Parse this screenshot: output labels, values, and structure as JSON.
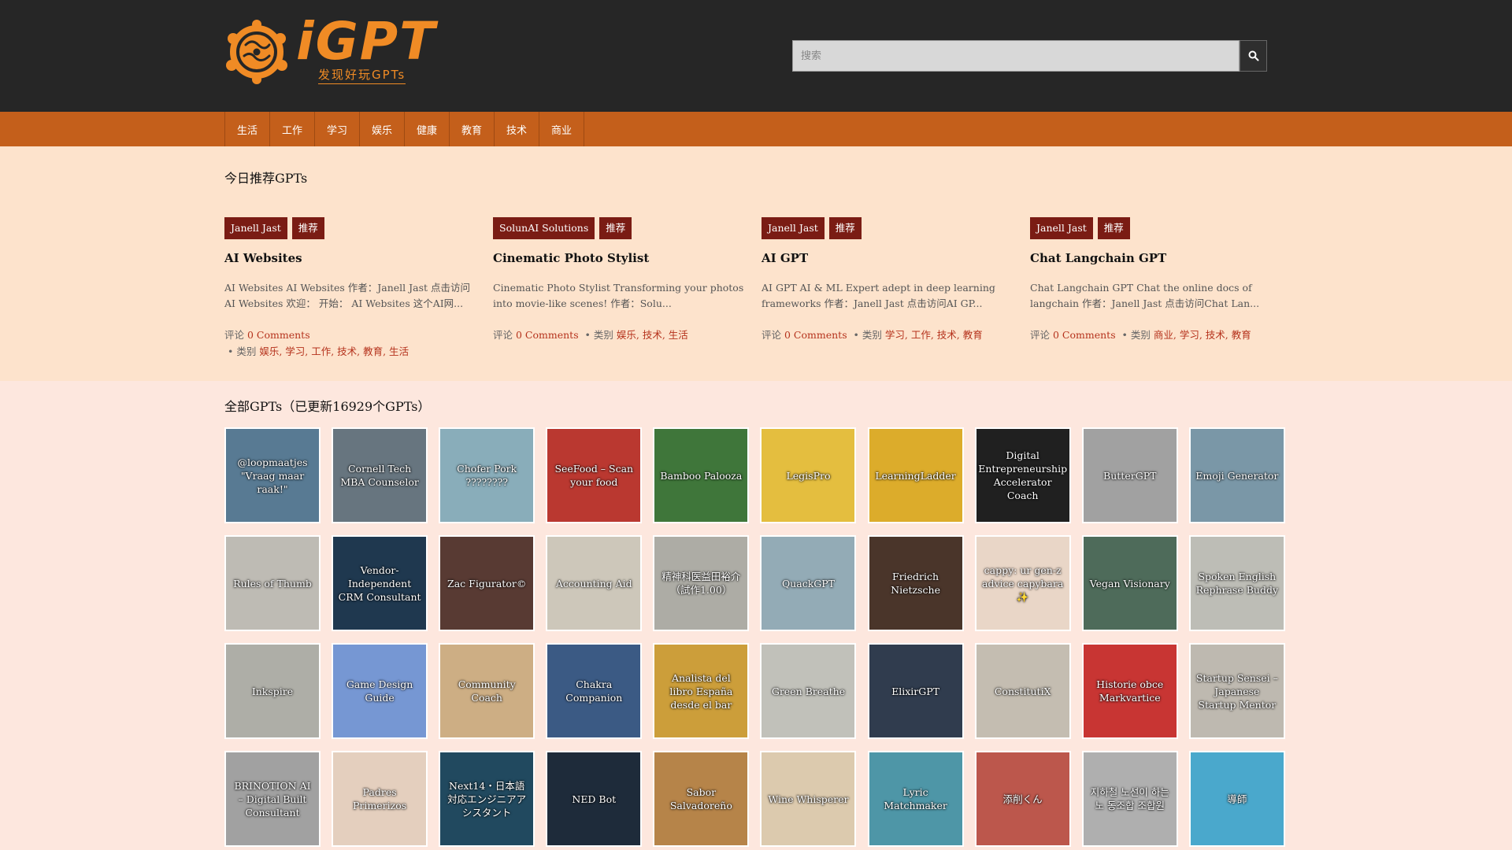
{
  "site": {
    "logo_text": "iGPT",
    "logo_sub": "发现好玩GPTs",
    "brand_color": "#f08b25"
  },
  "search": {
    "placeholder": "搜索"
  },
  "nav": [
    "生活",
    "工作",
    "学习",
    "娱乐",
    "健康",
    "教育",
    "技术",
    "商业"
  ],
  "featured": {
    "title": "今日推荐GPTs",
    "cards": [
      {
        "author": "Janell Jast",
        "badge": "推荐",
        "title": "AI Websites",
        "desc": "AI Websites AI Websites 作者：Janell Jast 点击访问AI Websites 欢迎： 开始： AI Websites 这个AI网...",
        "comments_label": "评论",
        "comments": "0 Comments",
        "category_label": "类别",
        "categories": "娱乐, 学习, 工作, 技术, 教育, 生活"
      },
      {
        "author": "SolunAI Solutions",
        "badge": "推荐",
        "title": "Cinematic Photo Stylist",
        "desc": "Cinematic Photo Stylist Transforming your photos into movie-like scenes! 作者：Solu...",
        "comments_label": "评论",
        "comments": "0 Comments",
        "category_label": "类别",
        "categories": "娱乐, 技术, 生活"
      },
      {
        "author": "Janell Jast",
        "badge": "推荐",
        "title": "AI GPT",
        "desc": "AI GPT AI & ML Expert adept in deep learning frameworks 作者：Janell Jast 点击访问AI GP...",
        "comments_label": "评论",
        "comments": "0 Comments",
        "category_label": "类别",
        "categories": "学习, 工作, 技术, 教育"
      },
      {
        "author": "Janell Jast",
        "badge": "推荐",
        "title": "Chat Langchain GPT",
        "desc": "Chat Langchain GPT Chat the online docs of langchain 作者：Janell Jast 点击访问Chat Lan...",
        "comments_label": "评论",
        "comments": "0 Comments",
        "category_label": "类别",
        "categories": "商业, 学习, 技术, 教育"
      }
    ]
  },
  "all": {
    "title": "全部GPTs（已更新16929个GPTs）",
    "tiles": [
      {
        "label": "@loopmaatjes \"Vraag maar raak!\"",
        "color": "#4a6f8a"
      },
      {
        "label": "Cornell Tech MBA Counselor",
        "color": "#5b6a75"
      },
      {
        "label": "Chofer Pork ????????",
        "color": "#7fa7b5"
      },
      {
        "label": "SeeFood – Scan your food",
        "color": "#b5281f"
      },
      {
        "label": "Bamboo Palooza",
        "color": "#2f6b2a"
      },
      {
        "label": "LegisPro",
        "color": "#e2b92f"
      },
      {
        "label": "LearningLadder",
        "color": "#d9a51a"
      },
      {
        "label": "Digital Entrepreneurship Accelerator Coach",
        "color": "#0e0e0e"
      },
      {
        "label": "ButterGPT",
        "color": "#9a9a9a"
      },
      {
        "label": "Emoji Generator",
        "color": "#6f8fa0"
      },
      {
        "label": "Rules of Thumb",
        "color": "#b9b6ae"
      },
      {
        "label": "Vendor-Independent CRM Consultant",
        "color": "#0d2840"
      },
      {
        "label": "Zac Figurator©",
        "color": "#4a2a22"
      },
      {
        "label": "Accounting Aid",
        "color": "#c9c3b5"
      },
      {
        "label": "精神科医益田裕介（試作1.00）",
        "color": "#a6a59e"
      },
      {
        "label": "QuackGPT",
        "color": "#8aa4b0"
      },
      {
        "label": "Friedrich Nietzsche",
        "color": "#3b2418"
      },
      {
        "label": "cappy: ur gen-z advice capybara ✨",
        "color": "#e8d3c3"
      },
      {
        "label": "Vegan Visionary",
        "color": "#3f5f4c"
      },
      {
        "label": "Spoken English Rephrase Buddy",
        "color": "#b8b8b0"
      },
      {
        "label": "Inkspire",
        "color": "#a8a8a0"
      },
      {
        "label": "Game Design Guide",
        "color": "#6b8fd0"
      },
      {
        "label": "Community Coach",
        "color": "#c9a87a"
      },
      {
        "label": "Chakra Companion",
        "color": "#2b4d7a"
      },
      {
        "label": "Analista del libro España desde el bar",
        "color": "#c8962a"
      },
      {
        "label": "Green Breathe",
        "color": "#bcbcb5"
      },
      {
        "label": "ElixirGPT",
        "color": "#1f2c3f"
      },
      {
        "label": "ConstitutiX",
        "color": "#bfb8ab"
      },
      {
        "label": "Historie obce Markvartice",
        "color": "#c42422"
      },
      {
        "label": "Startup Sensei – Japanese Startup Mentor",
        "color": "#b9b4aa"
      },
      {
        "label": "BRINOTION AI – Digital Built Consultant",
        "color": "#9a9a9a"
      },
      {
        "label": "Padres Primerizos",
        "color": "#e2cbb9"
      },
      {
        "label": "Next14・日本語対応エンジニアアシスタント",
        "color": "#0f3a52"
      },
      {
        "label": "NED Bot",
        "color": "#0b1a2a"
      },
      {
        "label": "Sabor Salvadoreño",
        "color": "#b07a3a"
      },
      {
        "label": "Wine Whisperer",
        "color": "#d9c6a8"
      },
      {
        "label": "Lyric Matchmaker",
        "color": "#3f8ea0"
      },
      {
        "label": "添削くん",
        "color": "#b7493d"
      },
      {
        "label": "지하철 노선이 하는 노 동조합 조합원",
        "color": "#a9a9a9"
      },
      {
        "label": "導師",
        "color": "#3ba1c8"
      }
    ]
  }
}
